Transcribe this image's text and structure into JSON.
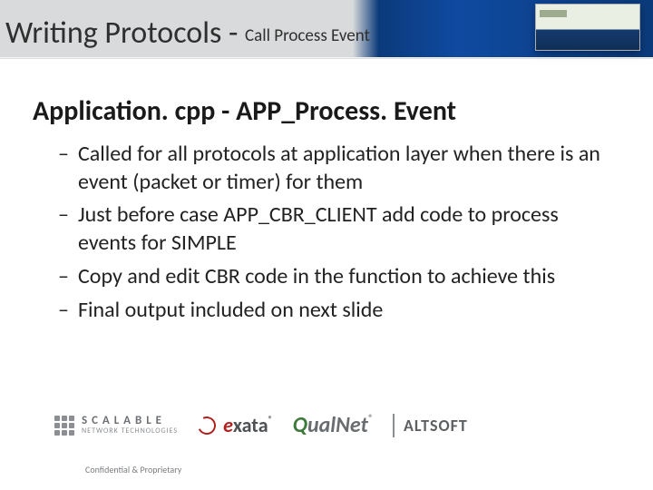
{
  "header": {
    "title_main": "Writing Protocols",
    "title_sep": "-",
    "title_sub": "Call Process Event"
  },
  "content": {
    "section_title": "Application. cpp - APP_Process. Event",
    "bullets": [
      "Called for all protocols at application layer when there is an event (packet or timer) for them",
      "Just before case APP_CBR_CLIENT add code to process events for SIMPLE",
      "Copy and edit CBR code in the function to achieve this",
      "Final output included on next slide"
    ]
  },
  "footer": {
    "scalable_line1": "S C A L A B L E",
    "scalable_line2": "NETWORK TECHNOLOGIES",
    "exata_red": "e",
    "exata_rest": "xata",
    "qualnet_q": "Q",
    "qualnet_rest": "ualNet",
    "altsoft": "ALTSOFT",
    "confidential": "Confidential & Proprietary"
  }
}
